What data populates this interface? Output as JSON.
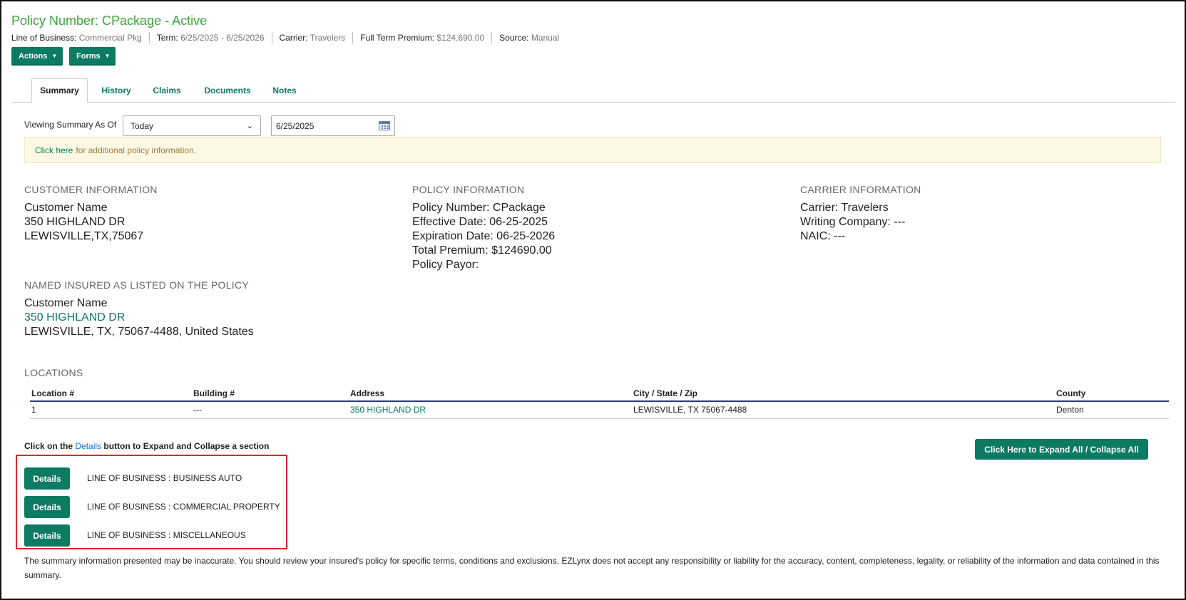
{
  "header": {
    "title": "Policy Number: CPackage - Active",
    "meta": [
      {
        "label": "Line of Business:",
        "value": "Commercial Pkg"
      },
      {
        "label": "Term:",
        "value": "6/25/2025 - 6/25/2026"
      },
      {
        "label": "Carrier:",
        "value": "Travelers"
      },
      {
        "label": "Full Term Premium:",
        "value": "$124,690.00"
      },
      {
        "label": "Source:",
        "value": "Manual"
      }
    ],
    "actions_label": "Actions",
    "forms_label": "Forms"
  },
  "tabs": [
    {
      "label": "Summary",
      "active": true
    },
    {
      "label": "History"
    },
    {
      "label": "Claims"
    },
    {
      "label": "Documents"
    },
    {
      "label": "Notes"
    }
  ],
  "viewing": {
    "label": "Viewing Summary As Of",
    "select_value": "Today",
    "date_value": "6/25/2025"
  },
  "notice": {
    "link": "Click here",
    "text": "for additional policy information."
  },
  "customer": {
    "heading": "CUSTOMER INFORMATION",
    "name": "Customer Name",
    "address": "350 HIGHLAND DR",
    "citystatezip": "LEWISVILLE,TX,75067"
  },
  "policy": {
    "heading": "POLICY INFORMATION",
    "number": "Policy Number: CPackage",
    "effective": "Effective Date: 06-25-2025",
    "expiration": "Expiration Date: 06-25-2026",
    "premium": "Total Premium: $124690.00",
    "payor": "Policy Payor:"
  },
  "carrier": {
    "heading": "CARRIER INFORMATION",
    "carrier": "Carrier: Travelers",
    "writing": "Writing Company: ---",
    "naic": "NAIC: ---"
  },
  "named_insured": {
    "heading": "NAMED INSURED AS LISTED ON THE POLICY",
    "name": "Customer Name",
    "address": "350 HIGHLAND DR",
    "citystatezip": "LEWISVILLE, TX, 75067-4488, United States"
  },
  "locations": {
    "heading": "LOCATIONS",
    "columns": [
      "Location #",
      "Building #",
      "Address",
      "City / State / Zip",
      "County"
    ],
    "rows": [
      [
        "1",
        "---",
        "350 HIGHLAND DR",
        "LEWISVILLE, TX 75067-4488",
        "Denton"
      ]
    ]
  },
  "details": {
    "hint_pre": "Click on the",
    "hint_link": "Details",
    "hint_post": "button to Expand and Collapse a section",
    "expand_all": "Click Here to Expand All / Collapse All",
    "button_label": "Details",
    "sections": [
      "LINE OF BUSINESS : BUSINESS AUTO",
      "LINE OF BUSINESS : COMMERCIAL PROPERTY",
      "LINE OF BUSINESS : MISCELLANEOUS"
    ]
  },
  "disclaimer": "The summary information presented may be inaccurate. You should review your insured's policy for specific terms, conditions and exclusions. EZLynx does not accept any responsibility or liability for the accuracy, content, completeness, legality, or reliability of the information and data contained in this summary.",
  "colors": {
    "brand_green": "#0d7a63",
    "title_green": "#3aa63a",
    "highlight_red": "#e0242a",
    "table_rule": "#2b3b80"
  }
}
